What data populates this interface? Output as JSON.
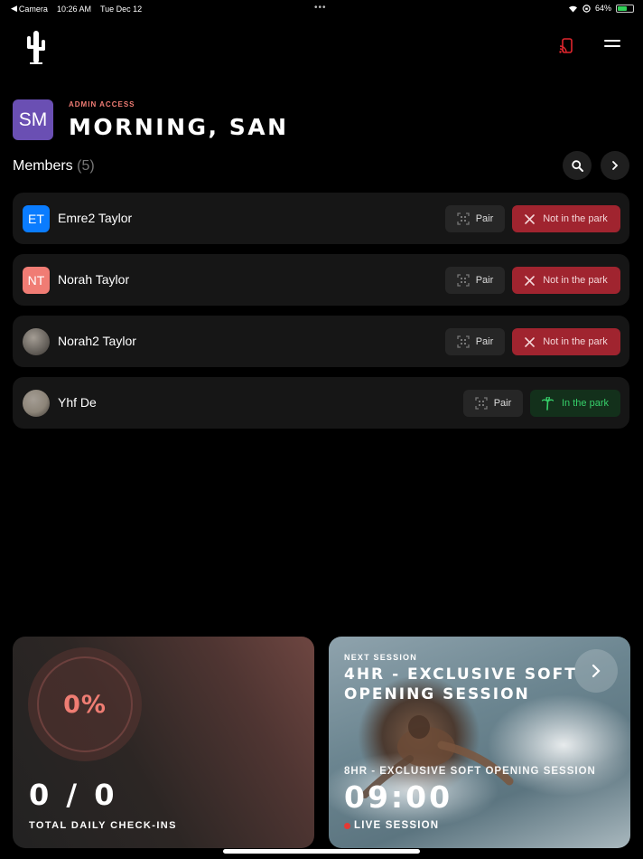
{
  "status_bar": {
    "back_label": "Camera",
    "time": "10:26 AM",
    "date": "Tue Dec 12",
    "battery": "64%",
    "battery_level": 0.64
  },
  "header": {
    "admin_label": "ADMIN ACCESS",
    "greeting": "MORNING, SAN",
    "avatar_initials": "SM",
    "avatar_color": "#6a4fb3"
  },
  "members": {
    "title": "Members",
    "count": "(5)",
    "rows": [
      {
        "initials": "ET",
        "name": "Emre2 Taylor",
        "avatar_color": "#0a7cff",
        "avatar_type": "initials",
        "pair_label": "Pair",
        "status_label": "Not in the park",
        "status": "out"
      },
      {
        "initials": "NT",
        "name": "Norah Taylor",
        "avatar_color": "#f07c74",
        "avatar_type": "initials",
        "pair_label": "Pair",
        "status_label": "Not in the park",
        "status": "out"
      },
      {
        "initials": "",
        "name": "Norah2 Taylor",
        "avatar_color": "#6b6660",
        "avatar_type": "photo",
        "pair_label": "Pair",
        "status_label": "Not in the park",
        "status": "out"
      },
      {
        "initials": "",
        "name": "Yhf De",
        "avatar_color": "#8c8478",
        "avatar_type": "photo",
        "pair_label": "Pair",
        "status_label": "In the park",
        "status": "in"
      }
    ]
  },
  "checkins": {
    "percent": "0%",
    "count": "0 / 0",
    "label": "TOTAL DAILY CHECK-INS"
  },
  "session": {
    "next_label": "NEXT SESSION",
    "next_title": "4HR - EXCLUSIVE SOFT OPENING SESSION",
    "current_title": "8HR - EXCLUSIVE SOFT OPENING SESSION",
    "current_time": "09:00",
    "live_label": "LIVE SESSION"
  },
  "colors": {
    "accent": "#f07c74",
    "status_out": "#a0242f",
    "status_in": "#36d06a",
    "cast_icon": "#e0262e"
  }
}
